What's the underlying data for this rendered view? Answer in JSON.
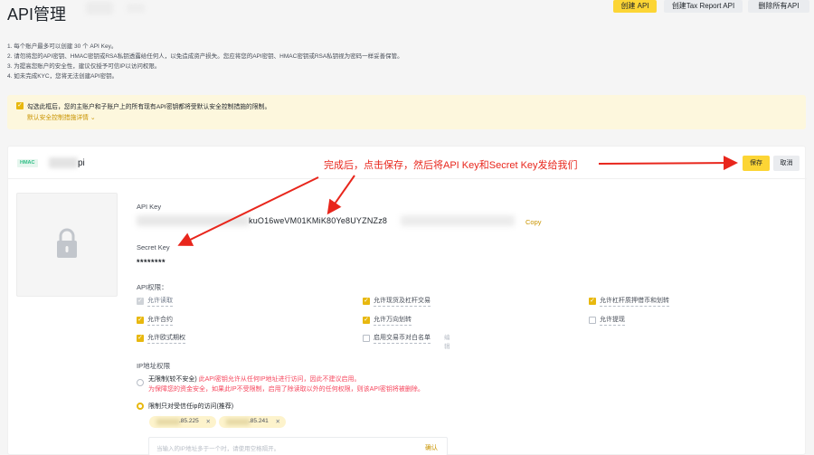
{
  "header": {
    "title": "API管理",
    "buttons": {
      "create": "创建 API",
      "tax": "创建Tax Report API",
      "delete": "删除所有API"
    }
  },
  "notes": [
    "1. 每个账户最多可以创建 30 个 API Key。",
    "2. 请勿将您的API密钥、HMAC密钥或RSA私钥透露给任何人，以免造成资产损失。您应将您的API密钥、HMAC密钥或RSA私钥视为密码一样妥善保管。",
    "3. 为提高您账户的安全性，建议仅授予可信IP以访问权限。",
    "4. 如未完成KYC，您将无法创建API密钥。"
  ],
  "warning": {
    "text": "勾选此框后，您的主账户和子账户上的所有现有API密钥都将受默认安全控制措施的限制。",
    "link": "默认安全控制措施详情 ⌄"
  },
  "card": {
    "tag": "HMAC",
    "name_suffix": "pi",
    "save_label": "保存",
    "cancel_label": "取消",
    "api_key_label": "API Key",
    "api_key_visible": "kuO16weVM01KMiK80Ye8UYZNZz8",
    "copy_label": "Copy",
    "secret_key_label": "Secret Key",
    "secret_key_value": "********",
    "permissions_label": "API权限：",
    "permissions": [
      {
        "label": "允许读取",
        "state": "disabled"
      },
      {
        "label": "允许现货及杠杆交易",
        "state": "checked"
      },
      {
        "label": "允许杠杆质押借币和划转",
        "state": "checked"
      },
      {
        "label": "允许合约",
        "state": "checked"
      },
      {
        "label": "允许万向划转",
        "state": "checked"
      },
      {
        "label": "允许提现",
        "state": "unchecked"
      },
      {
        "label": "允许欧式期权",
        "state": "checked"
      },
      {
        "label": "启用交易币对白名单",
        "state": "unchecked",
        "extra": "编辑"
      }
    ],
    "ip_label": "IP地址权限",
    "ip_unrestricted_label": "无限制(较不安全)",
    "ip_unrestricted_warning": "此API密钥允许从任何IP地址进行访问，因此不建议启用。",
    "ip_unrestricted_warning2": "为保障您的资金安全，如果此IP不受限制，启用了除读取以外的任何权限，则该API密钥将被删除。",
    "ip_restricted_label": "限制只对受信任ip的访问(推荐)",
    "ip_tags": [
      ".85.225",
      ".85.241"
    ],
    "ip_placeholder": "当输入的IP地址多于一个时，请使用空格隔开。",
    "ip_confirm": "确认"
  },
  "annotation": "完成后，点击保存，然后将API Key和Secret Key发给我们",
  "colors": {
    "accent": "#fcd535",
    "link": "#c99400",
    "danger": "#f6465d",
    "annotation": "#e8261c"
  }
}
